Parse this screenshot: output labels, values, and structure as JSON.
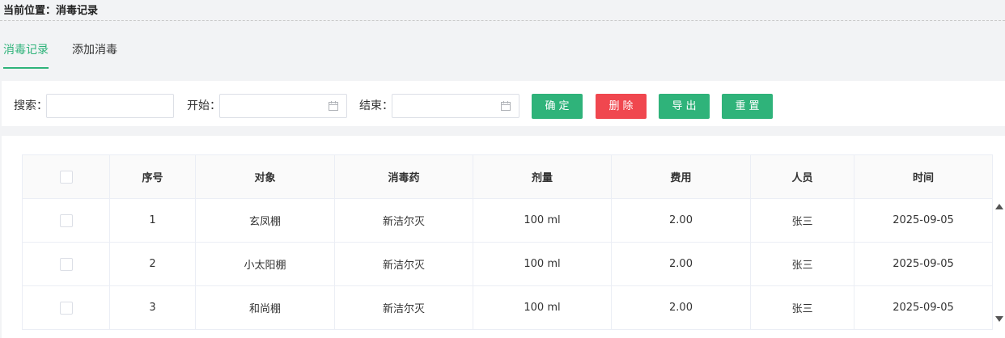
{
  "breadcrumb": {
    "text": "当前位置：消毒记录"
  },
  "tabs": [
    {
      "label": "消毒记录",
      "active": true
    },
    {
      "label": "添加消毒",
      "active": false
    }
  ],
  "filters": {
    "search_label": "搜索：",
    "start_label": "开始：",
    "end_label": "结束：",
    "search_value": "",
    "start_value": "",
    "end_value": ""
  },
  "buttons": {
    "confirm": "确定",
    "delete": "删除",
    "export": "导出",
    "reset": "重置"
  },
  "table": {
    "headers": [
      "序号",
      "对象",
      "消毒药",
      "剂量",
      "费用",
      "人员",
      "时间"
    ],
    "rows": [
      [
        "1",
        "玄凤棚",
        "新洁尔灭",
        "100 ml",
        "2.00",
        "张三",
        "2025-09-05"
      ],
      [
        "2",
        "小太阳棚",
        "新洁尔灭",
        "100 ml",
        "2.00",
        "张三",
        "2025-09-05"
      ],
      [
        "3",
        "和尚棚",
        "新洁尔灭",
        "100 ml",
        "2.00",
        "张三",
        "2025-09-05"
      ]
    ]
  },
  "colors": {
    "accent": "#2fb37a",
    "danger": "#f0474f",
    "background": "#f2f3f5"
  },
  "icons": {
    "date_picker": "calendar-icon",
    "scroll_up": "scroll-up-arrow-icon",
    "scroll_down": "scroll-down-arrow-icon"
  }
}
